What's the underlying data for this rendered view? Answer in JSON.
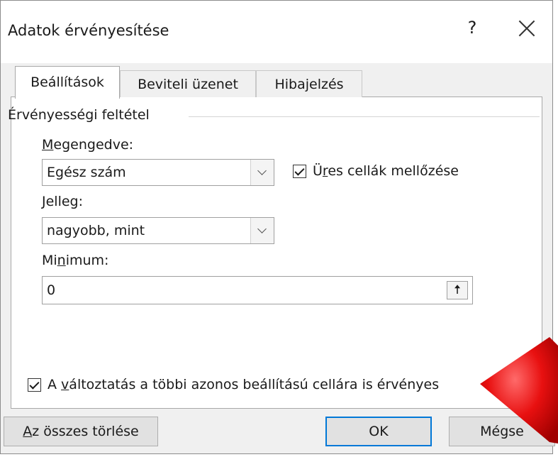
{
  "dialog": {
    "title": "Adatok érvényesítése",
    "help_label": "?",
    "close_icon": "close-icon"
  },
  "tabs": [
    {
      "label": "Beállítások",
      "active": true
    },
    {
      "label": "Beviteli üzenet",
      "active": false
    },
    {
      "label": "Hibajelzés",
      "active": false
    }
  ],
  "settings": {
    "group_label": "Érvényességi feltétel",
    "allow": {
      "label_accel": "M",
      "label_rest": "egengedve:",
      "value": "Egész szám"
    },
    "ignore_blank": {
      "label_pre": "Ü",
      "label_accel": "r",
      "label_rest": "es cellák mellőzése",
      "checked": true
    },
    "data": {
      "label_accel": "J",
      "label_rest": "elleg:",
      "value": "nagyobb, mint"
    },
    "minimum": {
      "label_pre": "Mi",
      "label_accel": "n",
      "label_rest": "imum:",
      "value": "0",
      "button_glyph": "🠅"
    },
    "apply_all": {
      "label_pre": "A ",
      "label_accel": "v",
      "label_rest": "áltoztatás a többi azonos beállítású cellára is érvényes",
      "checked": true
    }
  },
  "buttons": {
    "clear_accel": "A",
    "clear_rest": "z összes törlése",
    "ok": "OK",
    "cancel": "Mégse"
  },
  "colors": {
    "accent": "#0078d7",
    "pointer": "#e00000"
  }
}
